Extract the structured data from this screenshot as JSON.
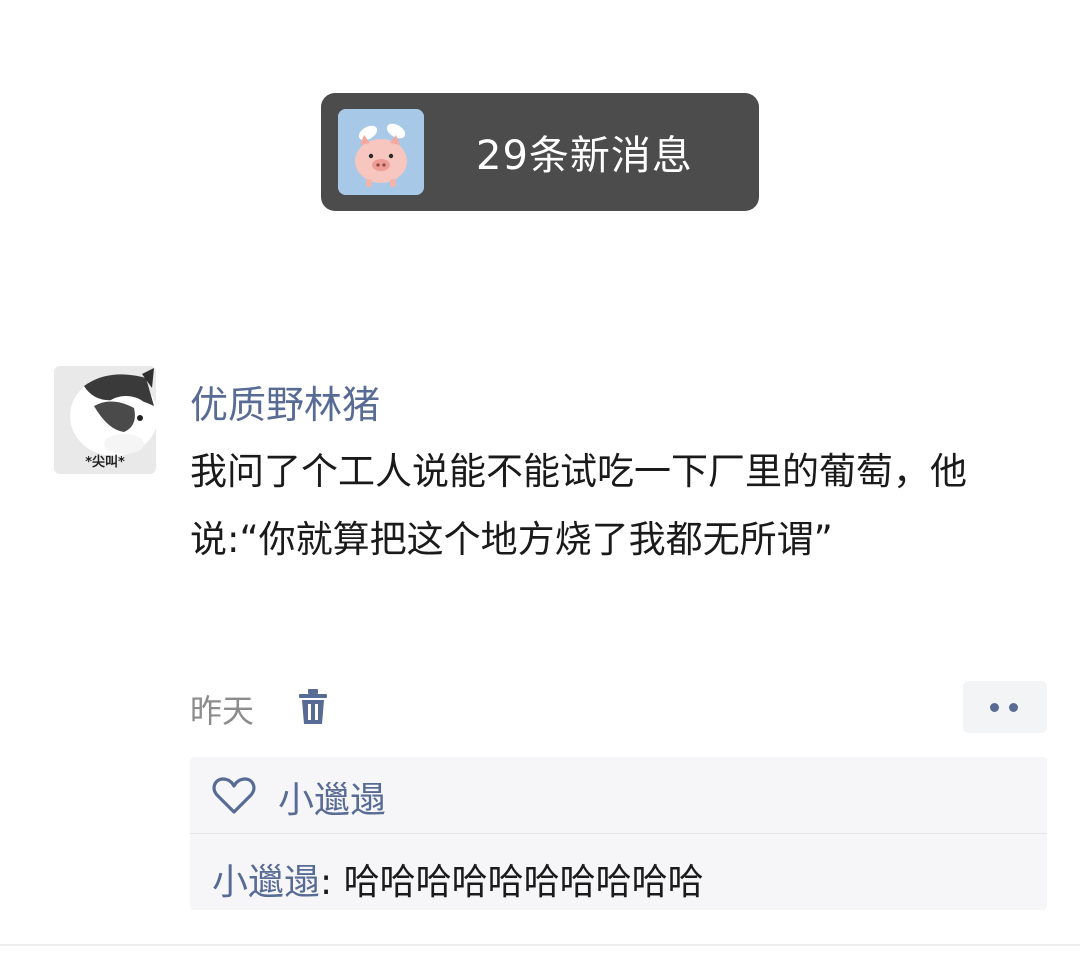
{
  "notice": {
    "text": "29条新消息",
    "avatar_icon": "pig-with-wings-icon"
  },
  "post": {
    "avatar_caption": "*尖叫*",
    "author": "优质野林猪",
    "content": "我问了个工人说能不能试吃一下厂里的葡萄，他说:“你就算把这个地方烧了我都无所谓”",
    "time": "昨天",
    "delete_icon": "trash-icon",
    "more_icon": "more-dots-icon"
  },
  "interactions": {
    "like_icon": "heart-outline-icon",
    "likes": "小邋遢",
    "comments": [
      {
        "name": "小邋遢",
        "sep": ": ",
        "text": "哈哈哈哈哈哈哈哈哈哈"
      }
    ]
  },
  "colors": {
    "link": "#576b95",
    "notice_bg": "#4c4c4c",
    "panel_bg": "#f6f6f8"
  }
}
